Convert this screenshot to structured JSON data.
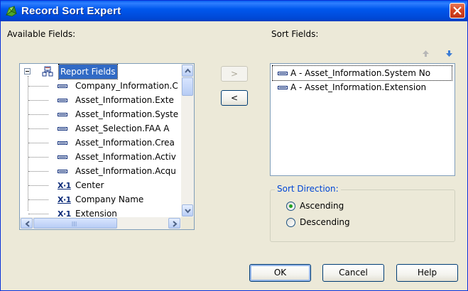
{
  "window": {
    "title": "Record Sort Expert",
    "close_icon": "close-icon",
    "app_icon": "crystal-reports-icon"
  },
  "available": {
    "label": "Available Fields:",
    "root": {
      "label": "Report Fields",
      "icon": "report-fields-icon"
    },
    "items": [
      {
        "label": "Company_Information.C",
        "icon": "database-field-icon"
      },
      {
        "label": "Asset_Information.Exte",
        "icon": "database-field-icon"
      },
      {
        "label": "Asset_Information.Syste",
        "icon": "database-field-icon"
      },
      {
        "label": "Asset_Selection.FAA A",
        "icon": "database-field-icon"
      },
      {
        "label": "Asset_Information.Crea",
        "icon": "database-field-icon"
      },
      {
        "label": "Asset_Information.Activ",
        "icon": "database-field-icon"
      },
      {
        "label": "Asset_Information.Acqu",
        "icon": "database-field-icon"
      },
      {
        "label": "Center",
        "icon": "formula-field-icon"
      },
      {
        "label": "Company Name",
        "icon": "formula-field-icon"
      },
      {
        "label": "Extension",
        "icon": "formula-field-icon"
      }
    ],
    "formula_glyph": "X·1"
  },
  "transfer": {
    "add_label": ">",
    "remove_label": "<"
  },
  "sort": {
    "label": "Sort Fields:",
    "items": [
      {
        "label": "A - Asset_Information.System No"
      },
      {
        "label": "A - Asset_Information.Extension"
      }
    ],
    "move_up_icon": "arrow-up-icon",
    "move_down_icon": "arrow-down-icon"
  },
  "direction": {
    "legend": "Sort Direction:",
    "options": [
      "Ascending",
      "Descending"
    ],
    "selected": "Ascending"
  },
  "buttons": {
    "ok": "OK",
    "cancel": "Cancel",
    "help": "Help"
  },
  "colors": {
    "title_bar": "#0058ee",
    "selection": "#316ac5",
    "radio_dot": "#21a121",
    "group_legend": "#0046d5"
  }
}
